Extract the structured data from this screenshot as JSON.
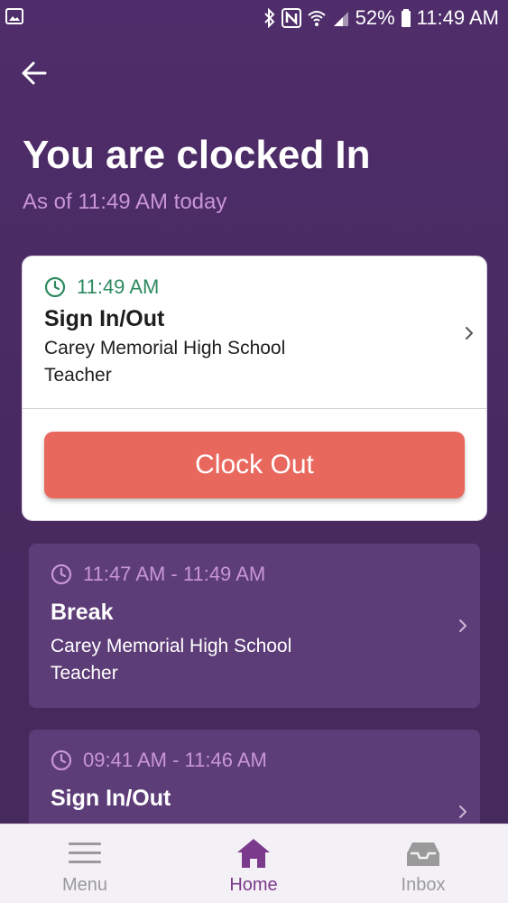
{
  "status_bar": {
    "battery_percent": "52%",
    "time": "11:49 AM",
    "icons": [
      "image-icon",
      "bluetooth-icon",
      "nfc-icon",
      "wifi-icon",
      "signal-icon",
      "battery-icon"
    ]
  },
  "header": {
    "title": "You are clocked In",
    "subtitle": "As of 11:49 AM today"
  },
  "active_entry": {
    "time": "11:49 AM",
    "type": "Sign In/Out",
    "location": "Carey Memorial High School",
    "role": "Teacher",
    "clock_out_label": "Clock Out"
  },
  "history": [
    {
      "time_range": "11:47 AM - 11:49 AM",
      "type": "Break",
      "location": "Carey Memorial High School",
      "role": "Teacher"
    },
    {
      "time_range": "09:41 AM - 11:46 AM",
      "type": "Sign In/Out"
    }
  ],
  "bottom_nav": {
    "menu_label": "Menu",
    "home_label": "Home",
    "inbox_label": "Inbox",
    "active": "Home"
  },
  "colors": {
    "background": "#4a2b63",
    "accent_green": "#2e8a60",
    "accent_pink": "#c895d8",
    "clock_out_button": "#e9685e",
    "history_card": "#5d3d78",
    "nav_active": "#7b3a8c"
  }
}
